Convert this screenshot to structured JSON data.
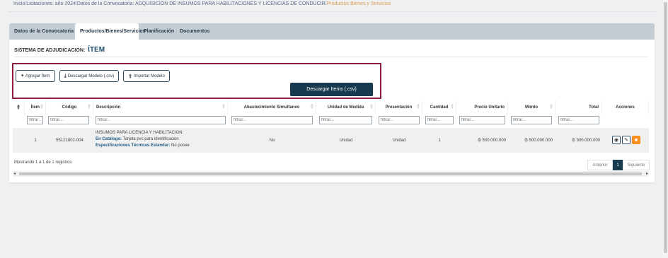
{
  "breadcrumb": {
    "items": [
      "Inicio",
      "Licitaciones: año 2024",
      "Datos de la Convocatoria: ADQUISICION DE INSUMOS PARA HABILITACIONES Y LICENCIAS DE CONDUCIR",
      "Productos Bienes y Servicios"
    ]
  },
  "tabs": [
    "Datos de la Convocatoria",
    "Productos/Bienes/Servicios",
    "Planificación",
    "Documentos"
  ],
  "section": {
    "label": "SISTEMA DE ADJUDICACIÓN:",
    "value": "ÍTEM"
  },
  "buttons": {
    "add": "Agregar Ítem",
    "download_model": "Descargar Modelo (.csv)",
    "import_model": "Importar Modelo",
    "download_items": "Descargar Items (.csv)"
  },
  "table": {
    "columns": [
      "Ítem",
      "Código",
      "Descripción",
      "Abastecimiento Simultaneo",
      "Unidad de Medida",
      "Presentación",
      "Cantidad",
      "Precio Unitario",
      "Monto",
      "Total",
      "Acciones"
    ],
    "filter_placeholder": "filtrar...",
    "rows": [
      {
        "item": "1",
        "codigo": "55121802-004",
        "desc_title": "INSUMOS PARA LICENCIA Y HABILITACION",
        "catalog_label": "En Catálogo:",
        "catalog_value": "Tarjeta pvc para identificacion",
        "specs_label": "Especificaciones Técnicas Estandar:",
        "specs_value": "No posee",
        "abastecimiento": "No",
        "unidad": "Unidad",
        "presentacion": "Unidad",
        "cantidad": "1",
        "precio": "₲ 500.000.000",
        "monto": "₲ 500.000.000",
        "total": "₲ 500.000.000"
      }
    ]
  },
  "footer": {
    "showing": "Mostrando 1 a 1 de 1 registros",
    "prev": "Anterior",
    "page": "1",
    "next": "Siguiente"
  },
  "colors": {
    "primary": "#183a4e",
    "accent": "#f6901e",
    "highlight_box": "#8b1d3d"
  }
}
